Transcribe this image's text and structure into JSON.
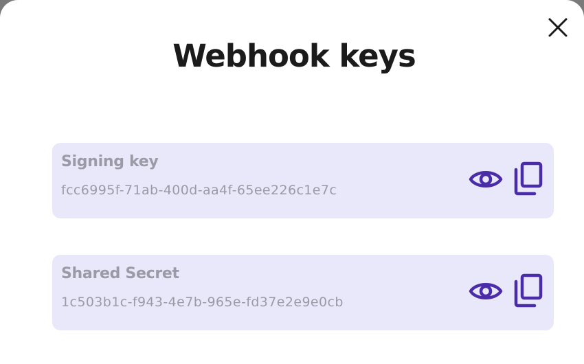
{
  "modal": {
    "title": "Webhook keys",
    "close_icon": "close-icon"
  },
  "keys": [
    {
      "label": "Signing key",
      "value": "fcc6995f-71ab-400d-aa4f-65ee226c1e7c",
      "reveal_icon": "eye-icon",
      "copy_icon": "copy-icon"
    },
    {
      "label": "Shared Secret",
      "value": "1c503b1c-f943-4e7b-965e-fd37e2e9e0cb",
      "reveal_icon": "eye-icon",
      "copy_icon": "copy-icon"
    }
  ],
  "colors": {
    "icon_accent": "#4b2ca8",
    "card_background": "#e9e8fb",
    "muted_text": "#9b9aa6",
    "title_text": "#1b1b1b"
  }
}
